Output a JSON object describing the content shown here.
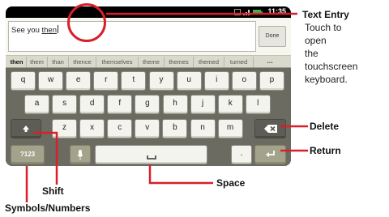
{
  "status_bar": {
    "time": "11:35",
    "icons": [
      "sim-icon",
      "signal-icon",
      "battery-icon"
    ]
  },
  "text_entry": {
    "value_prefix": "See you ",
    "value_word": "then",
    "done_label": "Done"
  },
  "suggestions": [
    "then",
    "them",
    "than",
    "thence",
    "themselves",
    "theme",
    "themes",
    "themed",
    "turned",
    "..."
  ],
  "keyboard": {
    "row1": [
      "q",
      "w",
      "e",
      "r",
      "t",
      "y",
      "u",
      "i",
      "o",
      "p"
    ],
    "row2": [
      "a",
      "s",
      "d",
      "f",
      "g",
      "h",
      "j",
      "k",
      "l"
    ],
    "row3": [
      "z",
      "x",
      "c",
      "v",
      "b",
      "n",
      "m"
    ],
    "symbols_label": "?123",
    "period_label": ".",
    "shift_icon": "shift-arrow-icon",
    "delete_icon": "backspace-icon",
    "return_icon": "return-arrow-icon",
    "mic_icon": "microphone-icon",
    "space_icon": "space-bar-icon"
  },
  "callouts": {
    "text_entry_title": "Text Entry",
    "text_entry_desc_1": "Touch to",
    "text_entry_desc_2": "open",
    "text_entry_desc_3": "the",
    "text_entry_desc_4": "touchscreen",
    "text_entry_desc_5": "keyboard.",
    "delete": "Delete",
    "return": "Return",
    "space": "Space",
    "shift": "Shift",
    "symbols": "Symbols/Numbers"
  },
  "colors": {
    "callout_line": "#d81f2a",
    "keyboard_bg": "#6b6b62",
    "key_face": "#f4f4ee"
  }
}
